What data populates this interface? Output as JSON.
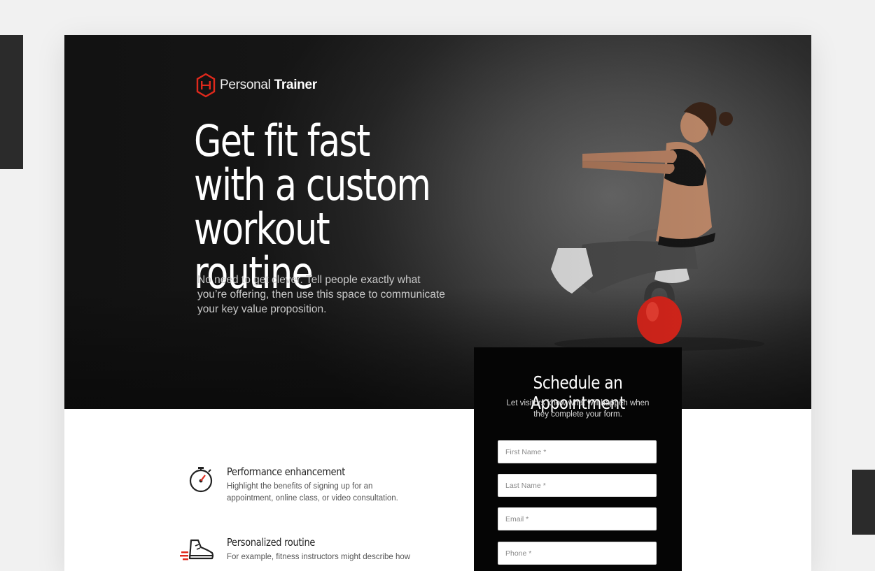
{
  "brand": {
    "name_light": "Personal",
    "name_bold": "Trainer",
    "accent": "#e0291c"
  },
  "hero": {
    "headline": "Get fit fast with a custom workout routine",
    "subtext": "No need to get clever. Tell people exactly what you’re offering, then use this space to communicate your key value proposition."
  },
  "form": {
    "title": "Schedule an Appointment",
    "description": "Let visitors know what will happen when they complete your form.",
    "fields": [
      {
        "placeholder": "First Name *"
      },
      {
        "placeholder": "Last Name *"
      },
      {
        "placeholder": "Email *"
      },
      {
        "placeholder": "Phone *"
      }
    ]
  },
  "features": [
    {
      "icon": "stopwatch-icon",
      "title": "Performance enhancement",
      "description": "Highlight the benefits of signing up for an appointment, online class, or video consultation."
    },
    {
      "icon": "sneaker-icon",
      "title": "Personalized routine",
      "description": "For example, fitness instructors might describe how"
    }
  ]
}
